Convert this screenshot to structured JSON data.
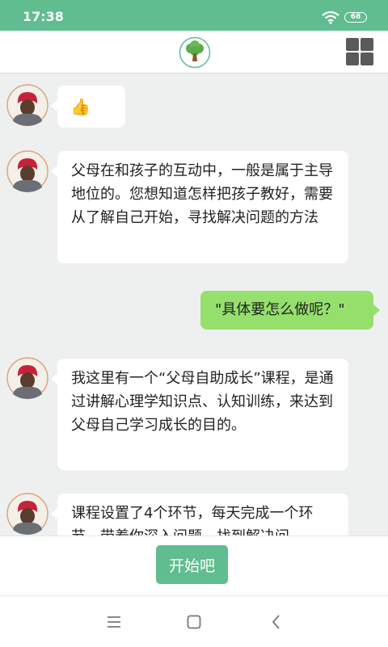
{
  "status_bar": {
    "time": "17:38",
    "battery": "68"
  },
  "header": {
    "logo_icon": "tree-logo-icon",
    "menu_icon": "grid-menu-icon"
  },
  "messages": [
    {
      "side": "left",
      "text": "👍"
    },
    {
      "side": "left",
      "text": "父母在和孩子的互动中，一般是属于主导地位的。您想知道怎样把孩子教好，需要从了解自己开始，寻找解决问题的方法"
    },
    {
      "side": "right",
      "text": "\"具体要怎么做呢？\""
    },
    {
      "side": "left",
      "text": "我这里有一个“父母自助成长”课程，是通过讲解心理学知识点、认知训练，来达到父母自己学习成长的目的。"
    },
    {
      "side": "left",
      "text": "课程设置了4个环节，每天完成一个环节，带着你深入问题，找到解决问"
    }
  ],
  "footer": {
    "start_label": "开始吧"
  },
  "colors": {
    "accent": "#5fbd8f",
    "sent_bubble": "#95e06c",
    "background": "#edf0ef"
  }
}
